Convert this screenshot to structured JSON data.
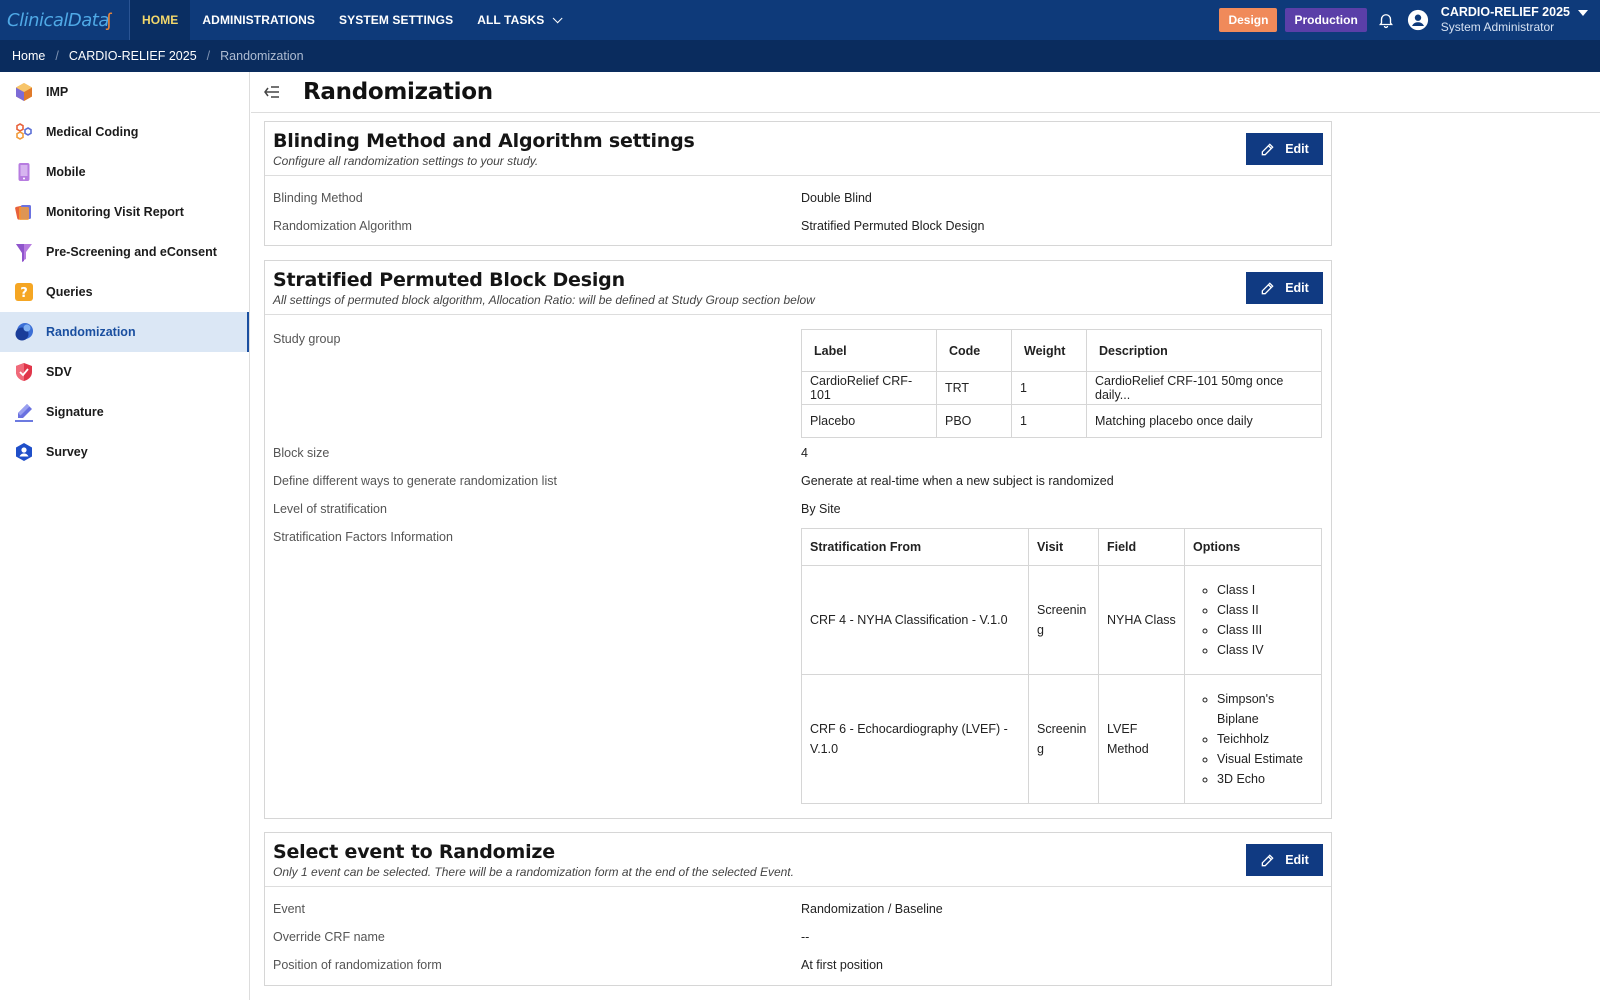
{
  "app": {
    "logo_text": "ClinicalData",
    "nav": [
      "HOME",
      "ADMINISTRATIONS",
      "SYSTEM SETTINGS",
      "ALL TASKS"
    ],
    "env_design": "Design",
    "env_production": "Production",
    "user_study": "CARDIO-RELIEF 2025",
    "user_role": "System Administrator"
  },
  "breadcrumb": [
    "Home",
    "CARDIO-RELIEF 2025",
    "Randomization"
  ],
  "sidebar": {
    "items": [
      {
        "label": "IMP",
        "icon": "cube-icon"
      },
      {
        "label": "Medical Coding",
        "icon": "hexagons-icon"
      },
      {
        "label": "Mobile",
        "icon": "mobile-icon"
      },
      {
        "label": "Monitoring Visit Report",
        "icon": "report-cards-icon"
      },
      {
        "label": "Pre-Screening and eConsent",
        "icon": "funnel-icon"
      },
      {
        "label": "Queries",
        "icon": "question-icon"
      },
      {
        "label": "Randomization",
        "icon": "randomization-icon"
      },
      {
        "label": "SDV",
        "icon": "shield-icon"
      },
      {
        "label": "Signature",
        "icon": "pen-icon"
      },
      {
        "label": "Survey",
        "icon": "survey-icon"
      }
    ],
    "active": "Randomization"
  },
  "page": {
    "title": "Randomization"
  },
  "blinding": {
    "title": "Blinding Method and Algorithm settings",
    "subtitle": "Configure all randomization settings to your study.",
    "edit": "Edit",
    "rows": [
      {
        "label": "Blinding Method",
        "value": "Double Blind"
      },
      {
        "label": "Randomization Algorithm",
        "value": "Stratified Permuted Block Design"
      }
    ]
  },
  "block": {
    "title": "Stratified Permuted Block Design",
    "subtitle": "All settings of permuted block algorithm, Allocation Ratio: will be defined at Study Group section below",
    "edit": "Edit",
    "study_group_label": "Study group",
    "study_group_headers": [
      "Label",
      "Code",
      "Weight",
      "Description"
    ],
    "study_group_rows": [
      [
        "CardioRelief CRF-101",
        "TRT",
        "1",
        "CardioRelief CRF-101 50mg once daily..."
      ],
      [
        "Placebo",
        "PBO",
        "1",
        "Matching placebo once daily"
      ]
    ],
    "rows": [
      {
        "label": "Block size",
        "value": "4"
      },
      {
        "label": "Define different ways to generate randomization list",
        "value": "Generate at real-time when a new subject is randomized"
      },
      {
        "label": "Level of stratification",
        "value": "By Site"
      }
    ],
    "strat_label": "Stratification Factors Information",
    "strat_headers": [
      "Stratification From",
      "Visit",
      "Field",
      "Options"
    ],
    "strat_rows": [
      {
        "from": "CRF 4 - NYHA Classification - V.1.0",
        "visit": "Screenin g",
        "field": "NYHA Class",
        "options": [
          "Class I",
          "Class II",
          "Class III",
          "Class IV"
        ]
      },
      {
        "from": "CRF 6 - Echocardiography (LVEF) - V.1.0",
        "visit": "Screenin g",
        "field": "LVEF Method",
        "options": [
          "Simpson's Biplane",
          "Teichholz",
          "Visual Estimate",
          "3D Echo"
        ]
      }
    ]
  },
  "event": {
    "title": "Select event to Randomize",
    "subtitle": "Only 1 event can be selected. There will be a randomization form at the end of the selected Event.",
    "edit": "Edit",
    "rows": [
      {
        "label": "Event",
        "value": "Randomization / Baseline"
      },
      {
        "label": "Override CRF name",
        "value": "--"
      },
      {
        "label": "Position of randomization form",
        "value": "At first position"
      }
    ]
  },
  "colors": {
    "topbar": "#0e3a7a",
    "breadcrumb_bar": "#0a2c5e",
    "accent_button": "#103a82",
    "design_badge": "#f08a5a",
    "production_badge": "#5a3fa8",
    "active_side": "#dbe7f5"
  }
}
